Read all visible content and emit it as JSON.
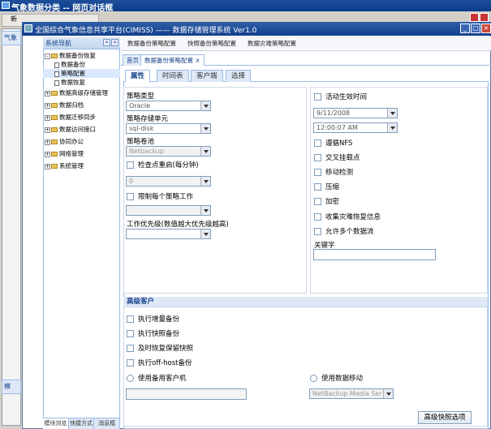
{
  "outer_window": {
    "title": "气象数据分类 -- 网页对话框"
  },
  "background_window": {
    "toolbar_label": "新",
    "tab_label": "气象",
    "section_label": "气象",
    "bottom_tab_label": "模"
  },
  "inner_window": {
    "title": "全国综合气象信息共享平台(CIMISS) —— 数据存储管理系统 Ver1.0",
    "buttons": [
      "_",
      "□",
      "×"
    ]
  },
  "sidebar": {
    "header": "系统导航",
    "tools": [
      "«",
      "»"
    ],
    "tree": [
      {
        "label": "数据备份恢复",
        "level": 0,
        "expanded": true
      },
      {
        "label": "数据备份",
        "level": 1
      },
      {
        "label": "策略配置",
        "level": 1,
        "selected": true
      },
      {
        "label": "数据恢复",
        "level": 1
      },
      {
        "label": "数据高级存储管理",
        "level": 0
      },
      {
        "label": "数据归档",
        "level": 0
      },
      {
        "label": "数据迁移同步",
        "level": 0
      },
      {
        "label": "数据访问接口",
        "level": 0
      },
      {
        "label": "协同办公",
        "level": 0
      },
      {
        "label": "网络管理",
        "level": 0
      },
      {
        "label": "系统管理",
        "level": 0
      }
    ],
    "bottom_tabs": [
      "模块浏览",
      "快捷方式",
      "消息框"
    ]
  },
  "menubar": [
    "数据备份策略配置",
    "快照备份策略配置",
    "数据灾难策略配置"
  ],
  "tabs": [
    {
      "label": "首页"
    },
    {
      "label": "数据备份策略配置 ×",
      "active": true
    }
  ],
  "subtabs": [
    {
      "label": "属性",
      "active": true
    },
    {
      "label": "时间表"
    },
    {
      "label": "客户端"
    },
    {
      "label": "选择"
    }
  ],
  "left_panel": {
    "policy_type_label": "策略类型",
    "policy_type_value": "Oracle",
    "storage_unit_label": "策略存储单元",
    "storage_unit_value": "sql-disk",
    "volume_pool_label": "策略卷池",
    "volume_pool_value": "Netbackup",
    "checkpoint_label": "检查点重启(每分钟)",
    "checkpoint_value": "0",
    "limit_jobs_label": "限制每个策略工作",
    "priority_label": "工作优先级(数值越大优先级越高)",
    "priority_value": ""
  },
  "right_panel": {
    "active_time_label": "活动生效时间",
    "date_value": "9/11/2008",
    "time_value": "12:00:07 AM",
    "checkboxes": [
      "遵循NFS",
      "交叉挂载点",
      "移动检测",
      "压缩",
      "加密",
      "收集灾难恢复信息",
      "允许多个数据流"
    ],
    "keyword_label": "关键字",
    "keyword_value": ""
  },
  "advanced": {
    "header": "高级客户",
    "checkboxes": [
      "执行增量备份",
      "执行快照备份",
      "及时恢复保留快照",
      "执行off-host备份"
    ],
    "radio_alt_client": "使用备用客户机",
    "radio_data_mover": "使用数据移动",
    "data_mover_value": "NetBackup Media Ser",
    "advanced_button": "高级快照选项"
  }
}
